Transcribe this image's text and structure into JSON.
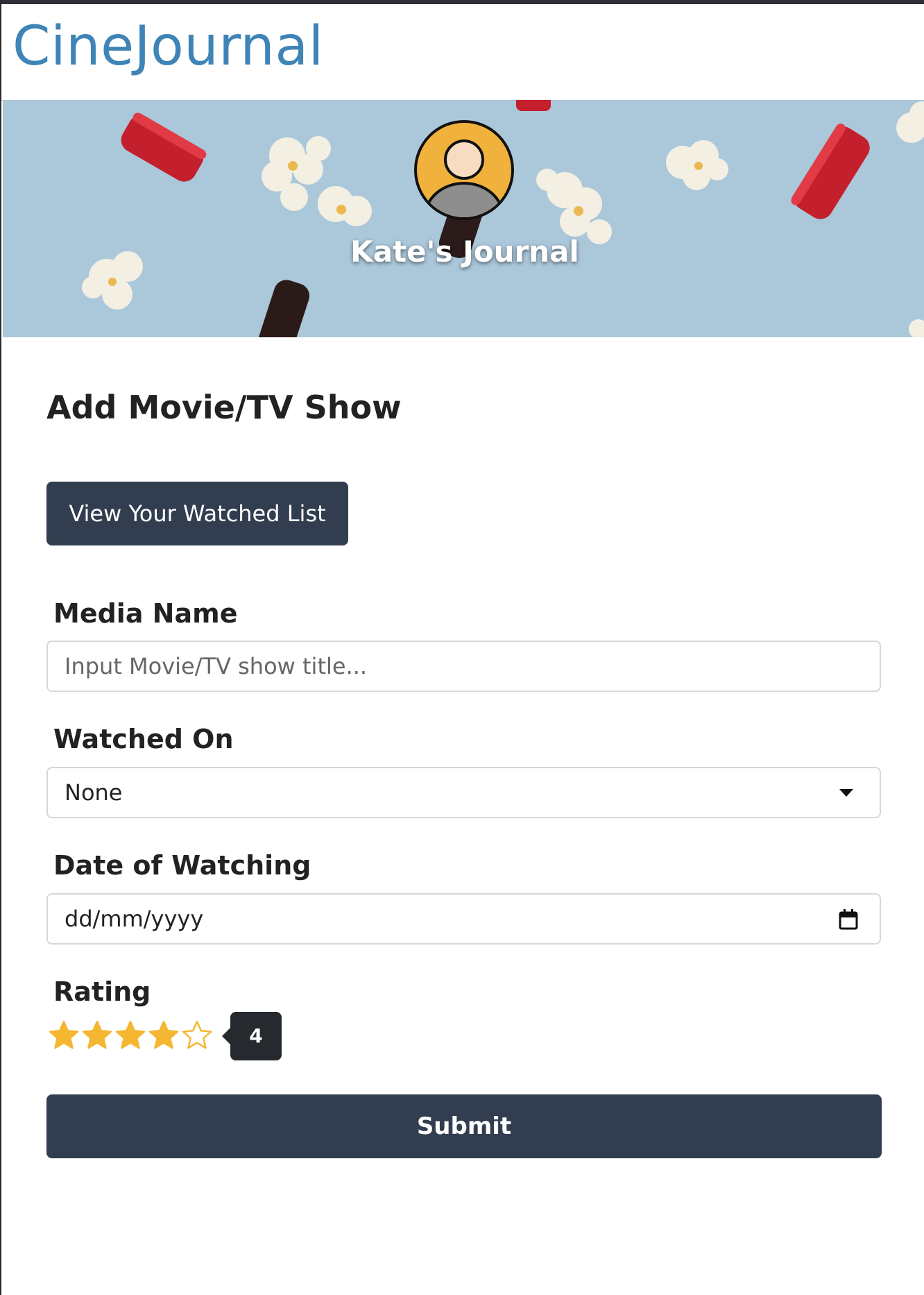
{
  "app": {
    "brand": "CineJournal"
  },
  "banner": {
    "avatar_icon": "user-avatar-icon",
    "journal_title": "Kate's Journal",
    "colors": {
      "background": "#aac6da",
      "avatar_ring": "#f0b23c"
    }
  },
  "form": {
    "title": "Add Movie/TV Show",
    "watched_list_button": "View Your Watched List",
    "media_name": {
      "label": "Media Name",
      "placeholder": "Input Movie/TV show title...",
      "value": ""
    },
    "watched_on": {
      "label": "Watched On",
      "selected": "None"
    },
    "date": {
      "label": "Date of Watching",
      "placeholder": "dd/mm/yyyy",
      "icon": "calendar-icon"
    },
    "rating": {
      "label": "Rating",
      "value": 4,
      "max": 5,
      "tooltip": "4",
      "star_color": "#f5b731"
    },
    "submit": "Submit"
  },
  "colors": {
    "accent_brand": "#3f84b6",
    "button": "#323e4f"
  }
}
